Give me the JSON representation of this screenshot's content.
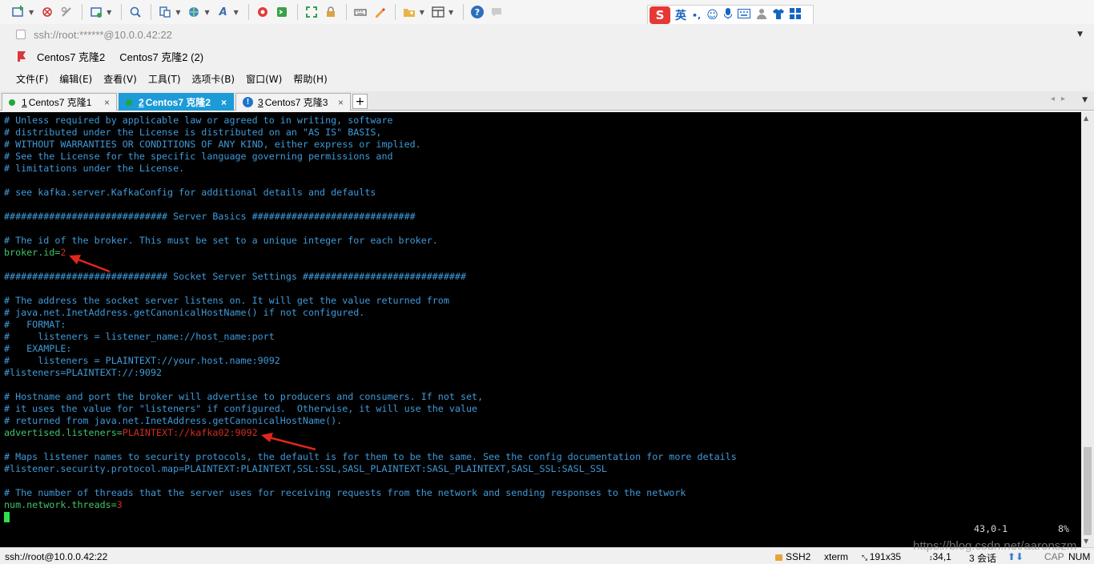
{
  "toolbar": {
    "icons": [
      "new-session-icon",
      "reconnect-icon",
      "disconnect-icon",
      "properties-icon",
      "find-icon",
      "transfer-icon",
      "globe-icon",
      "font-icon",
      "xftp-icon",
      "xshell-icon",
      "fullscreen-icon",
      "lock-icon",
      "keyboard-icon",
      "highlight-icon",
      "new-tab-icon",
      "layout-icon",
      "help-icon",
      "chat-icon"
    ]
  },
  "ime": {
    "logo": "S",
    "lang": "英",
    "punct": "•,",
    "icons": [
      "emoji-icon",
      "microphone-icon",
      "keyboard-icon",
      "user-icon",
      "skin-icon",
      "grid-icon"
    ]
  },
  "address": {
    "text": "ssh://root:******@10.0.0.42:22"
  },
  "session_bar": {
    "links": [
      "Centos7 克隆2",
      "Centos7 克隆2 (2)"
    ]
  },
  "menu": {
    "items": [
      "文件(F)",
      "编辑(E)",
      "查看(V)",
      "工具(T)",
      "选项卡(B)",
      "窗口(W)",
      "帮助(H)"
    ]
  },
  "tabs": [
    {
      "num": "1",
      "label": "Centos7 克隆1",
      "status": "connected",
      "active": false
    },
    {
      "num": "2",
      "label": "Centos7 克隆2",
      "status": "connected",
      "active": true
    },
    {
      "num": "3",
      "label": "Centos7 克隆3",
      "status": "warning",
      "active": false
    }
  ],
  "terminal": {
    "lines": [
      {
        "text": "# Unless required by applicable law or agreed to in writing, software"
      },
      {
        "text": "# distributed under the License is distributed on an \"AS IS\" BASIS,"
      },
      {
        "text": "# WITHOUT WARRANTIES OR CONDITIONS OF ANY KIND, either express or implied."
      },
      {
        "text": "# See the License for the specific language governing permissions and"
      },
      {
        "text": "# limitations under the License."
      },
      {
        "text": ""
      },
      {
        "text": "# see kafka.server.KafkaConfig for additional details and defaults"
      },
      {
        "text": ""
      },
      {
        "text": "############################# Server Basics #############################"
      },
      {
        "text": ""
      },
      {
        "text": "# The id of the broker. This must be set to a unique integer for each broker."
      },
      {
        "key": "broker.id",
        "value": "2"
      },
      {
        "text": ""
      },
      {
        "text": "############################# Socket Server Settings #############################"
      },
      {
        "text": ""
      },
      {
        "text": "# The address the socket server listens on. It will get the value returned from"
      },
      {
        "text": "# java.net.InetAddress.getCanonicalHostName() if not configured."
      },
      {
        "text": "#   FORMAT:"
      },
      {
        "text": "#     listeners = listener_name://host_name:port"
      },
      {
        "text": "#   EXAMPLE:"
      },
      {
        "text": "#     listeners = PLAINTEXT://your.host.name:9092"
      },
      {
        "text": "#listeners=PLAINTEXT://:9092"
      },
      {
        "text": ""
      },
      {
        "text": "# Hostname and port the broker will advertise to producers and consumers. If not set,"
      },
      {
        "text": "# it uses the value for \"listeners\" if configured.  Otherwise, it will use the value"
      },
      {
        "text": "# returned from java.net.InetAddress.getCanonicalHostName()."
      },
      {
        "key": "advertised.listeners",
        "value": "PLAINTEXT://kafka02:9092"
      },
      {
        "text": ""
      },
      {
        "text": "# Maps listener names to security protocols, the default is for them to be the same. See the config documentation for more details"
      },
      {
        "text": "#listener.security.protocol.map=PLAINTEXT:PLAINTEXT,SSL:SSL,SASL_PLAINTEXT:SASL_PLAINTEXT,SASL_SSL:SASL_SSL"
      },
      {
        "text": ""
      },
      {
        "text": "# The number of threads that the server uses for receiving requests from the network and sending responses to the network"
      },
      {
        "key": "num.network.threads",
        "value": "3"
      }
    ],
    "cursor_pos": "43,0-1",
    "scroll_pct": "8%",
    "colors": {
      "comment": "#3f9ad9",
      "key": "#3fc46b",
      "value": "#d52b1e",
      "cursor": "#2ee04d",
      "annotation_arrow": "#e0261b"
    }
  },
  "status": {
    "connection": "ssh://root@10.0.0.42:22",
    "protocol": "SSH2",
    "term": "xterm",
    "size": "191x35",
    "position": "34,1",
    "sessions": "3 会话",
    "caps": "CAP",
    "num": "NUM"
  },
  "watermark": "https://blog.csdn.net/aaronszm"
}
